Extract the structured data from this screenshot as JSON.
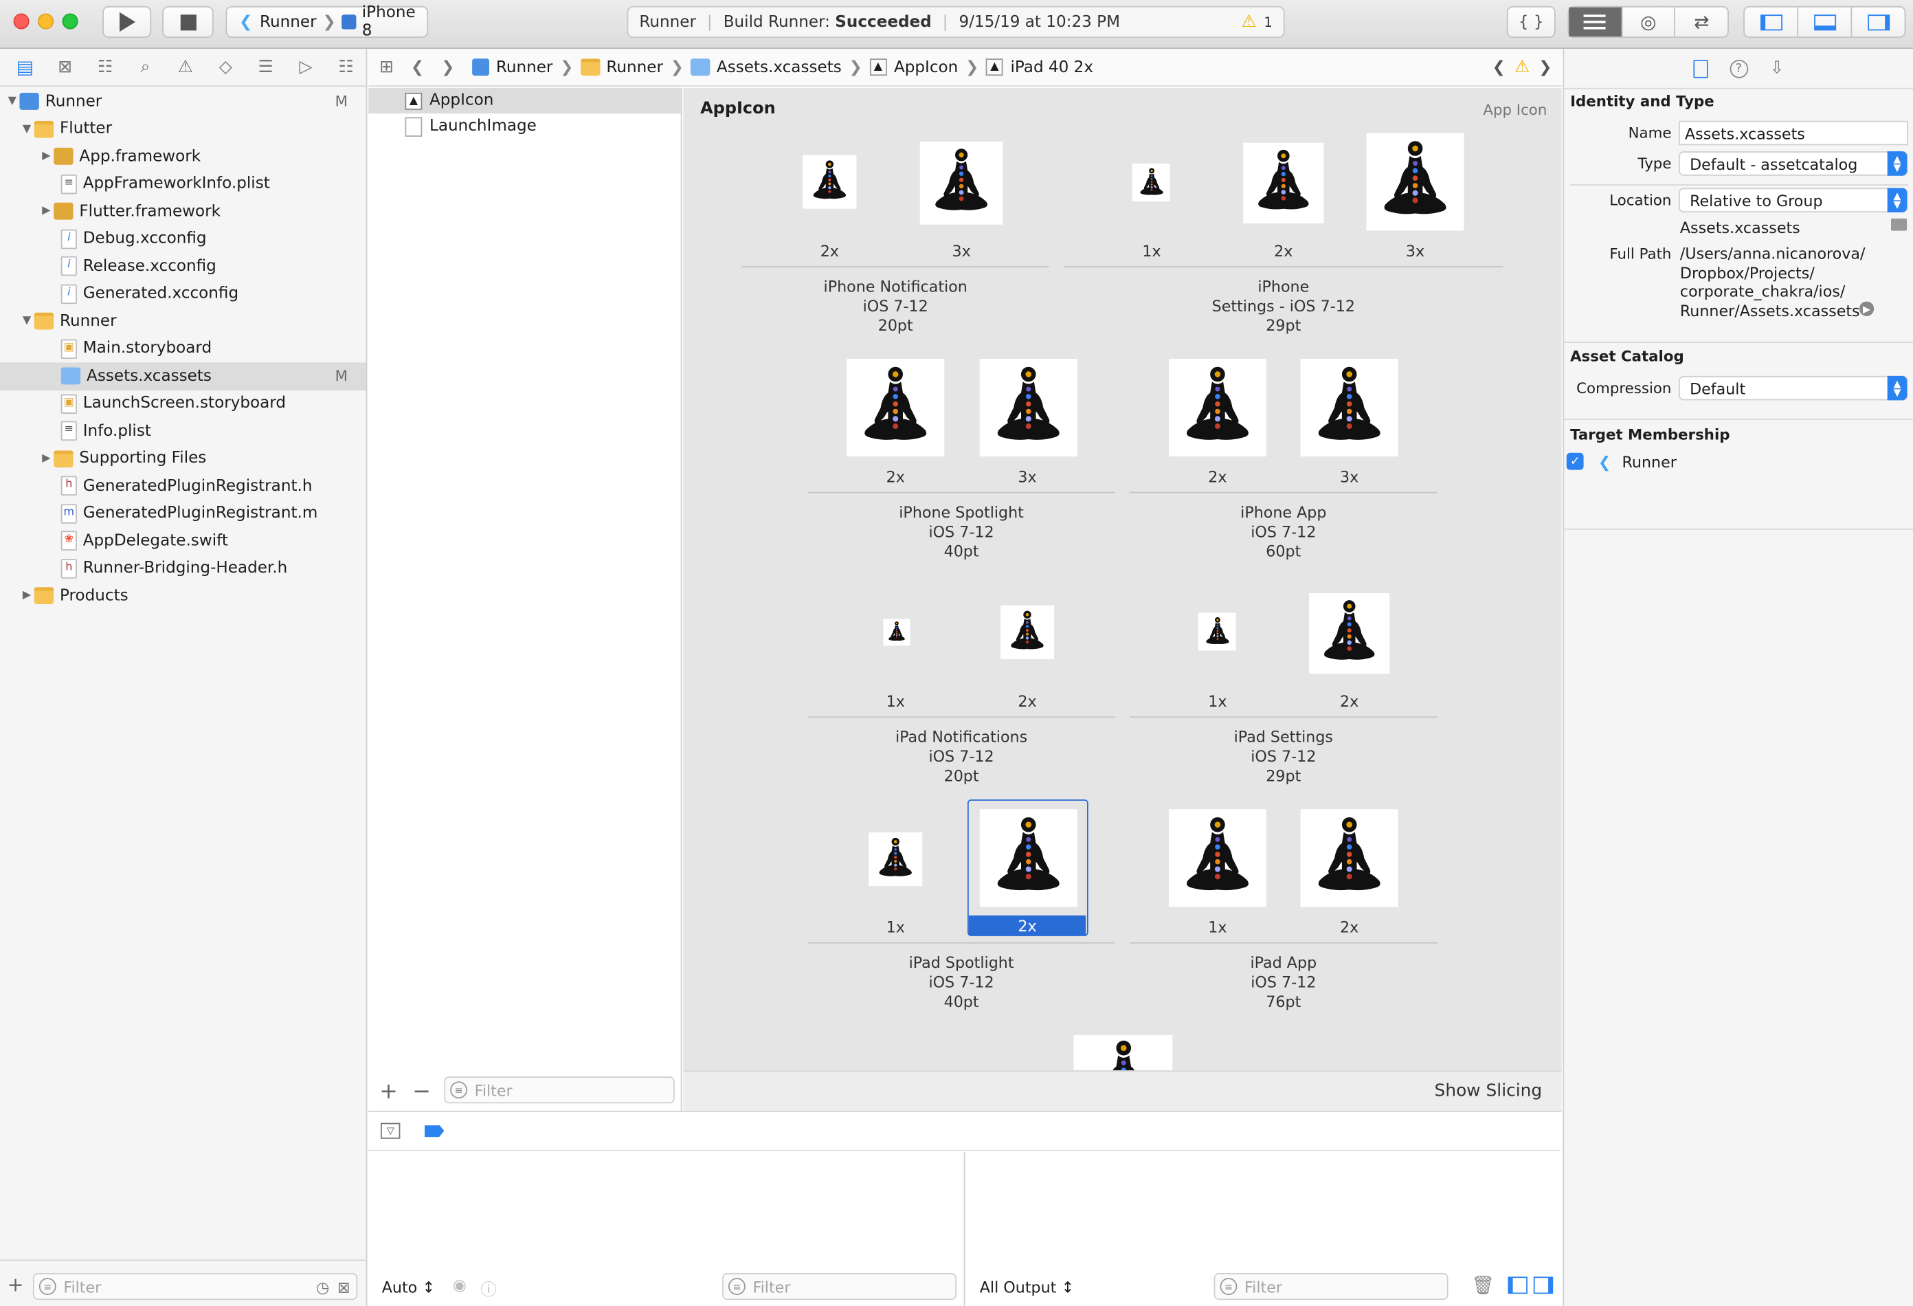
{
  "toolbar": {
    "scheme": "Runner",
    "device": "iPhone 8",
    "activity_app": "Runner",
    "activity_prefix": "Build Runner: ",
    "activity_status": "Succeeded",
    "activity_time": "9/15/19 at 10:23 PM",
    "warning_count": "1",
    "braces": "{ }"
  },
  "navigator": {
    "items": [
      {
        "label": "Runner",
        "badge": "M"
      },
      {
        "label": "Flutter"
      },
      {
        "label": "App.framework"
      },
      {
        "label": "AppFrameworkInfo.plist"
      },
      {
        "label": "Flutter.framework"
      },
      {
        "label": "Debug.xcconfig"
      },
      {
        "label": "Release.xcconfig"
      },
      {
        "label": "Generated.xcconfig"
      },
      {
        "label": "Runner"
      },
      {
        "label": "Main.storyboard"
      },
      {
        "label": "Assets.xcassets",
        "badge": "M"
      },
      {
        "label": "LaunchScreen.storyboard"
      },
      {
        "label": "Info.plist"
      },
      {
        "label": "Supporting Files"
      },
      {
        "label": "GeneratedPluginRegistrant.h"
      },
      {
        "label": "GeneratedPluginRegistrant.m"
      },
      {
        "label": "AppDelegate.swift"
      },
      {
        "label": "Runner-Bridging-Header.h"
      },
      {
        "label": "Products"
      }
    ],
    "filter_placeholder": "Filter"
  },
  "jumpbar": {
    "crumbs": [
      "Runner",
      "Runner",
      "Assets.xcassets",
      "AppIcon",
      "iPad 40 2x"
    ]
  },
  "asset_list": {
    "items": [
      "AppIcon",
      "LaunchImage"
    ],
    "filter_placeholder": "Filter"
  },
  "canvas": {
    "title": "AppIcon",
    "type_label": "App Icon",
    "groups": [
      {
        "slots": [
          "2x",
          "3x"
        ],
        "l1": "iPhone Notification",
        "l2": "iOS 7-12",
        "l3": "20pt"
      },
      {
        "slots": [
          "1x",
          "2x",
          "3x"
        ],
        "l1": "iPhone",
        "l2": "Settings - iOS 7-12",
        "l3": "29pt"
      },
      {
        "slots": [
          "2x",
          "3x"
        ],
        "l1": "iPhone Spotlight",
        "l2": "iOS 7-12",
        "l3": "40pt"
      },
      {
        "slots": [
          "2x",
          "3x"
        ],
        "l1": "iPhone App",
        "l2": "iOS 7-12",
        "l3": "60pt"
      },
      {
        "slots": [
          "1x",
          "2x"
        ],
        "l1": "iPad Notifications",
        "l2": "iOS 7-12",
        "l3": "20pt"
      },
      {
        "slots": [
          "1x",
          "2x"
        ],
        "l1": "iPad Settings",
        "l2": "iOS 7-12",
        "l3": "29pt"
      },
      {
        "slots": [
          "1x",
          "2x"
        ],
        "l1": "iPad Spotlight",
        "l2": "iOS 7-12",
        "l3": "40pt"
      },
      {
        "slots": [
          "1x",
          "2x"
        ],
        "l1": "iPad App",
        "l2": "iOS 7-12",
        "l3": "76pt"
      }
    ],
    "show_slicing": "Show Slicing"
  },
  "debug": {
    "auto_label": "Auto ↕",
    "output_label": "All Output ↕",
    "filter_placeholder": "Filter"
  },
  "inspector": {
    "identity_header": "Identity and Type",
    "name_label": "Name",
    "name_value": "Assets.xcassets",
    "type_label": "Type",
    "type_value": "Default - assetcatalog",
    "location_label": "Location",
    "location_value": "Relative to Group",
    "location_file": "Assets.xcassets",
    "fullpath_label": "Full Path",
    "fullpath_lines": [
      "/Users/anna.nicanorova/",
      "Dropbox/Projects/",
      "corporate_chakra/ios/",
      "Runner/Assets.xcassets"
    ],
    "catalog_header": "Asset Catalog",
    "compression_label": "Compression",
    "compression_value": "Default",
    "membership_header": "Target Membership",
    "target_name": "Runner"
  },
  "colors": {
    "accent": "#2a83f0",
    "selection": "#2a6cd6",
    "warning": "#f0b400"
  }
}
